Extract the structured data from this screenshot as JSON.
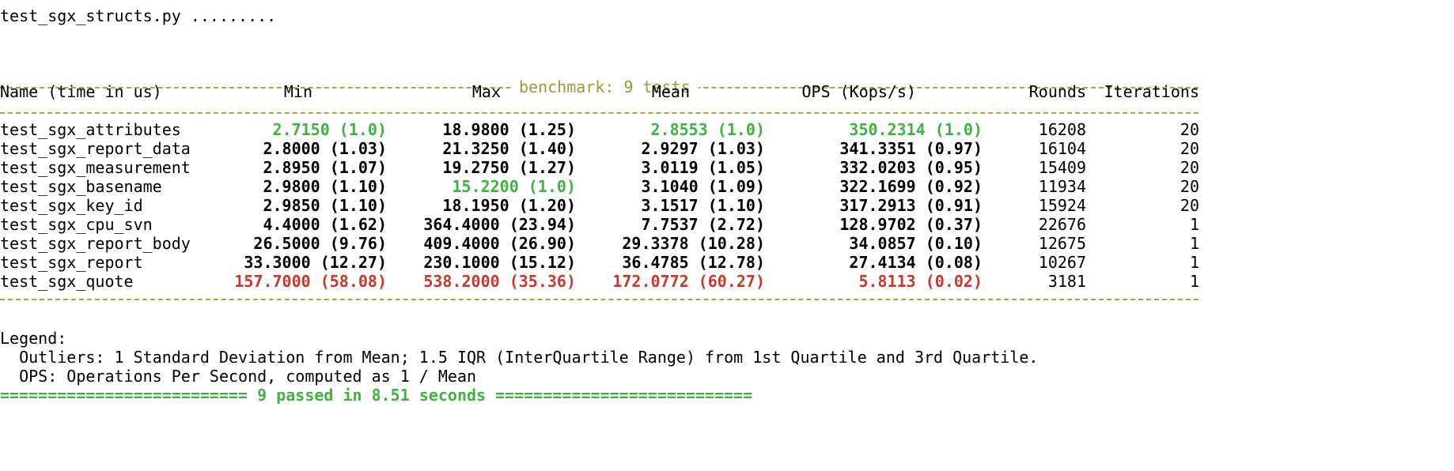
{
  "header_line": "test_sgx_structs.py .........",
  "benchmark_title": "benchmark: 9 tests",
  "columns": {
    "name": "Name (time in us)",
    "min": "Min",
    "max": "Max",
    "mean": "Mean",
    "ops": "OPS (Kops/s)",
    "rounds": "Rounds",
    "iterations": "Iterations"
  },
  "rows": [
    {
      "name": "test_sgx_attributes",
      "min": "2.7150 (1.0)",
      "min_c": "green",
      "max": "18.9800 (1.25)",
      "max_c": "",
      "mean": "2.8553 (1.0)",
      "mean_c": "green",
      "ops": "350.2314 (1.0)",
      "ops_c": "green",
      "rounds": "16208",
      "iterations": "20"
    },
    {
      "name": "test_sgx_report_data",
      "min": "2.8000 (1.03)",
      "min_c": "",
      "max": "21.3250 (1.40)",
      "max_c": "",
      "mean": "2.9297 (1.03)",
      "mean_c": "",
      "ops": "341.3351 (0.97)",
      "ops_c": "",
      "rounds": "16104",
      "iterations": "20"
    },
    {
      "name": "test_sgx_measurement",
      "min": "2.8950 (1.07)",
      "min_c": "",
      "max": "19.2750 (1.27)",
      "max_c": "",
      "mean": "3.0119 (1.05)",
      "mean_c": "",
      "ops": "332.0203 (0.95)",
      "ops_c": "",
      "rounds": "15409",
      "iterations": "20"
    },
    {
      "name": "test_sgx_basename",
      "min": "2.9800 (1.10)",
      "min_c": "",
      "max": "15.2200 (1.0)",
      "max_c": "green",
      "mean": "3.1040 (1.09)",
      "mean_c": "",
      "ops": "322.1699 (0.92)",
      "ops_c": "",
      "rounds": "11934",
      "iterations": "20"
    },
    {
      "name": "test_sgx_key_id",
      "min": "2.9850 (1.10)",
      "min_c": "",
      "max": "18.1950 (1.20)",
      "max_c": "",
      "mean": "3.1517 (1.10)",
      "mean_c": "",
      "ops": "317.2913 (0.91)",
      "ops_c": "",
      "rounds": "15924",
      "iterations": "20"
    },
    {
      "name": "test_sgx_cpu_svn",
      "min": "4.4000 (1.62)",
      "min_c": "",
      "max": "364.4000 (23.94)",
      "max_c": "",
      "mean": "7.7537 (2.72)",
      "mean_c": "",
      "ops": "128.9702 (0.37)",
      "ops_c": "",
      "rounds": "22676",
      "iterations": "1"
    },
    {
      "name": "test_sgx_report_body",
      "min": "26.5000 (9.76)",
      "min_c": "",
      "max": "409.4000 (26.90)",
      "max_c": "",
      "mean": "29.3378 (10.28)",
      "mean_c": "",
      "ops": "34.0857 (0.10)",
      "ops_c": "",
      "rounds": "12675",
      "iterations": "1"
    },
    {
      "name": "test_sgx_report",
      "min": "33.3000 (12.27)",
      "min_c": "",
      "max": "230.1000 (15.12)",
      "max_c": "",
      "mean": "36.4785 (12.78)",
      "mean_c": "",
      "ops": "27.4134 (0.08)",
      "ops_c": "",
      "rounds": "10267",
      "iterations": "1"
    },
    {
      "name": "test_sgx_quote",
      "min": "157.7000 (58.08)",
      "min_c": "red",
      "max": "538.2000 (35.36)",
      "max_c": "red",
      "mean": "172.0772 (60.27)",
      "mean_c": "red",
      "ops": "5.8113 (0.02)",
      "ops_c": "red",
      "rounds": "3181",
      "iterations": "1"
    }
  ],
  "legend": {
    "title": "Legend:",
    "outliers": "  Outliers: 1 Standard Deviation from Mean; 1.5 IQR (InterQuartile Range) from 1st Quartile and 3rd Quartile.",
    "ops": "  OPS: Operations Per Second, computed as 1 / Mean"
  },
  "footer": "========================== 9 passed in 8.51 seconds ==========================="
}
